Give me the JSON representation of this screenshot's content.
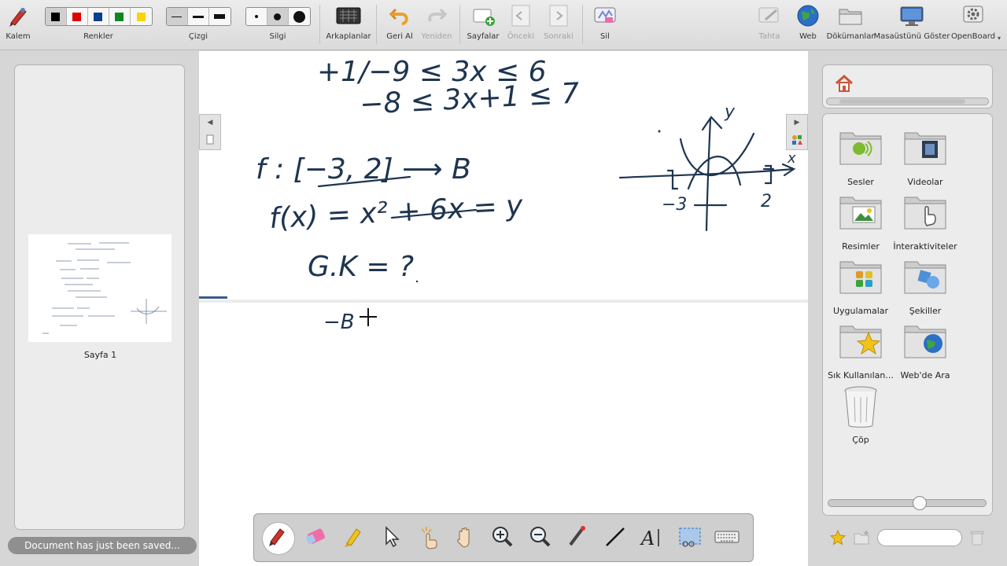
{
  "toolbar": {
    "pen_label": "Kalem",
    "colors_label": "Renkler",
    "line_label": "Çizgi",
    "eraser_label": "Silgi",
    "backgrounds_label": "Arkaplanlar",
    "undo_label": "Geri Al",
    "redo_label": "Yeniden",
    "pages_label": "Sayfalar",
    "previous_label": "Önceki",
    "next_label": "Sonraki",
    "erase_label": "Sil",
    "board_label": "Tahta",
    "web_label": "Web",
    "documents_label": "Dökümanlar",
    "desktop_label": "Masaüstünü Göster",
    "openboard_label": "OpenBoard",
    "colors": [
      "#000000",
      "#e00000",
      "#0a3f8c",
      "#10871e",
      "#f6d500"
    ]
  },
  "pages_panel": {
    "page_label": "Sayfa 1",
    "status": "Document has just been saved..."
  },
  "library": {
    "items": [
      {
        "label": "Sesler",
        "icon": "sounds-folder-icon"
      },
      {
        "label": "Videolar",
        "icon": "videos-folder-icon"
      },
      {
        "label": "Resimler",
        "icon": "images-folder-icon"
      },
      {
        "label": "İnteraktiviteler",
        "icon": "interactivities-folder-icon"
      },
      {
        "label": "Uygulamalar",
        "icon": "applications-folder-icon"
      },
      {
        "label": "Şekiller",
        "icon": "shapes-folder-icon"
      },
      {
        "label": "Sık Kullanılan...",
        "icon": "favorites-folder-icon"
      },
      {
        "label": "Web'de Ara",
        "icon": "web-search-folder-icon"
      },
      {
        "label": "Çöp",
        "icon": "trash-icon"
      }
    ]
  },
  "board": {
    "ink": {
      "line1": "+1/−9 ≤ 3x ≤ 6",
      "line2": "−8 ≤ 3x+1 ≤ 7",
      "line3": "f : [−3, 2] ⟶ B",
      "line4": "f(x) = x² + 6x = y",
      "line5": "G.K = ?",
      "line6": "−B",
      "axis_x": "x",
      "axis_y": "y",
      "mark_neg3": "−3",
      "mark_2": "2"
    }
  },
  "dock": {
    "tools": [
      "pen-tool-icon",
      "eraser-tool-icon",
      "highlighter-tool-icon",
      "selector-tool-icon",
      "interact-tool-icon",
      "hand-tool-icon",
      "zoom-in-tool-icon",
      "zoom-out-tool-icon",
      "laser-pointer-tool-icon",
      "line-tool-icon",
      "text-tool-icon",
      "capture-tool-icon",
      "keyboard-tool-icon"
    ]
  }
}
